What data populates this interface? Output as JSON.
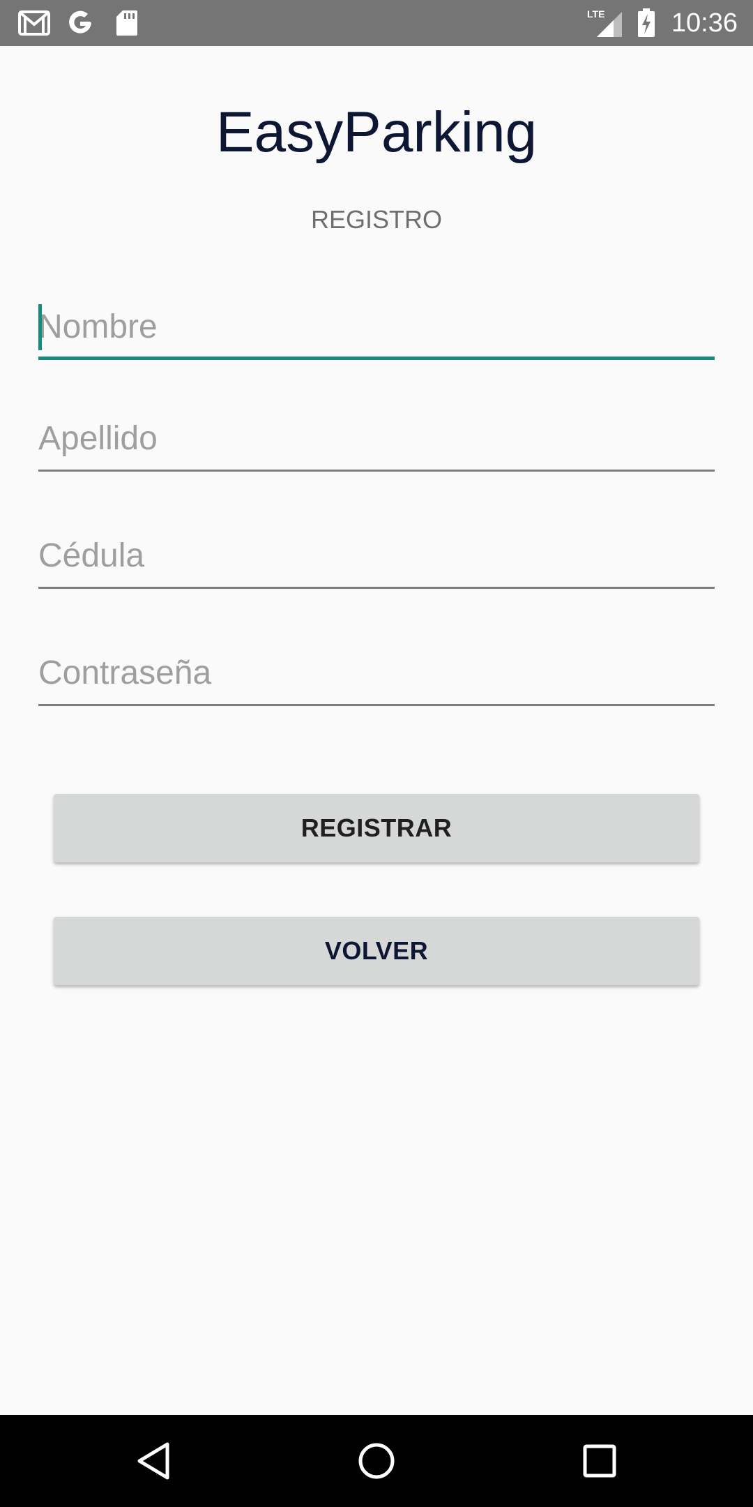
{
  "status_bar": {
    "time": "10:36",
    "network_label": "LTE",
    "icons": [
      "gmail-icon",
      "google-icon",
      "sd-card-icon",
      "lte-signal-icon",
      "battery-charging-icon"
    ]
  },
  "header": {
    "app_title": "EasyParking",
    "subtitle": "REGISTRO"
  },
  "form": {
    "fields": [
      {
        "name": "nombre",
        "placeholder": "Nombre",
        "value": "",
        "focused": true
      },
      {
        "name": "apellido",
        "placeholder": "Apellido",
        "value": "",
        "focused": false
      },
      {
        "name": "cedula",
        "placeholder": "Cédula",
        "value": "",
        "focused": false
      },
      {
        "name": "contrasena",
        "placeholder": "Contraseña",
        "value": "",
        "focused": false
      }
    ],
    "register_label": "REGISTRAR",
    "back_label": "VOLVER"
  },
  "nav_bar": {
    "icons": [
      "back-triangle-icon",
      "home-circle-icon",
      "recents-square-icon"
    ]
  },
  "colors": {
    "status_bar": "#757575",
    "background": "#fafafa",
    "accent": "#1a8a7a",
    "title": "#0d1733",
    "button_bg": "#d6d7d7",
    "nav_bar": "#000000"
  }
}
